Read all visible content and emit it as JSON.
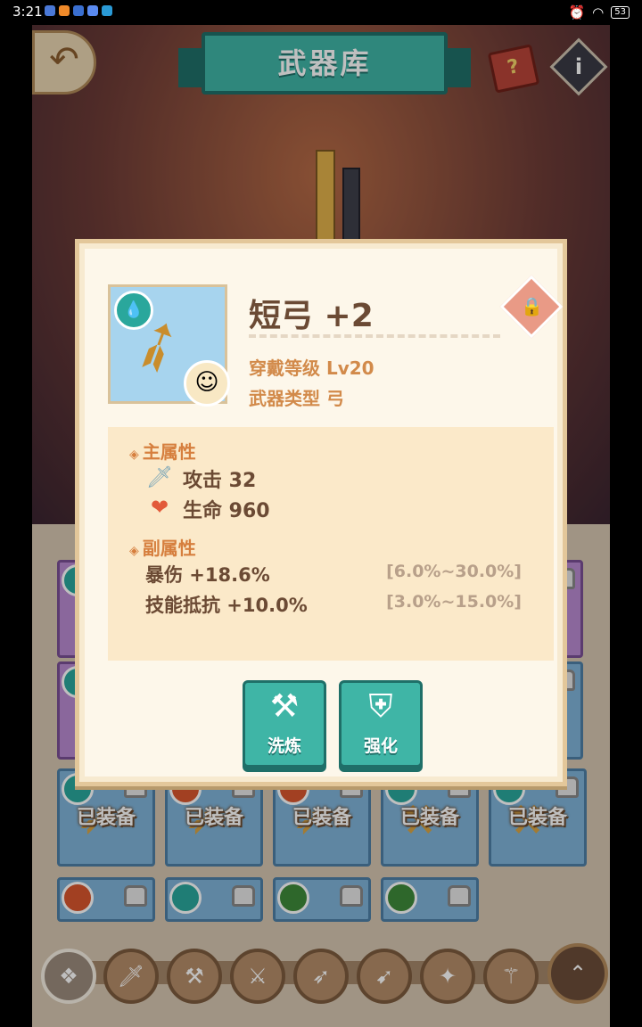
{
  "status_bar": {
    "time": "3:21",
    "battery": "53"
  },
  "header": {
    "title": "武器库",
    "back_icon": "back-arrow-icon",
    "book_icon": "?",
    "info_icon": "i"
  },
  "dialog": {
    "weapon_name": "短弓 +2",
    "required_level": "穿戴等级 Lv20",
    "weapon_type": "武器类型 弓",
    "element": "water",
    "main_section_title": "主属性",
    "main_stats": [
      {
        "icon": "sword-icon",
        "text": "攻击 32"
      },
      {
        "icon": "heart-icon",
        "text": "生命 960"
      }
    ],
    "sub_section_title": "副属性",
    "sub_stats": [
      {
        "text": "暴伤 +18.6%",
        "range": "[6.0%~30.0%]"
      },
      {
        "text": "技能抵抗 +10.0%",
        "range": "[3.0%~15.0%]"
      }
    ],
    "buttons": [
      {
        "label": "洗炼",
        "icon": "anvil-icon"
      },
      {
        "label": "强化",
        "icon": "shield-sword-icon"
      }
    ]
  },
  "grid": {
    "equipped_label": "已装备",
    "row3": [
      {
        "element": "water"
      },
      {
        "element": "fire"
      },
      {
        "element": "fire"
      },
      {
        "element": "water"
      },
      {
        "element": "water"
      }
    ],
    "row4": [
      {
        "element": "fire"
      },
      {
        "element": "water"
      },
      {
        "element": "wind"
      },
      {
        "element": "wind"
      }
    ]
  },
  "bottom_nav": [
    "all-icon",
    "sword-icon",
    "hammer-icon",
    "axe-icon",
    "bow-icon",
    "spear-icon",
    "gun-icon",
    "staff-icon",
    "collapse-icon"
  ],
  "colors": {
    "accent": "#3fb5a6",
    "accent_dark": "#1f6f68",
    "text_brown": "#6b4a34",
    "label_orange": "#d28a4a"
  }
}
